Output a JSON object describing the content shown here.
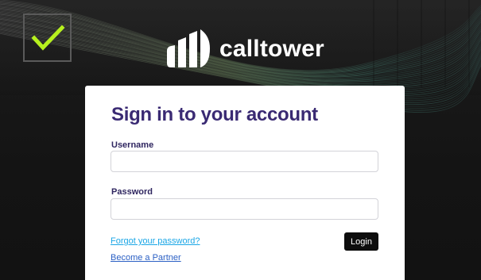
{
  "app": {
    "brand_name": "calltower"
  },
  "icons": {
    "status": "checkmark-icon",
    "logo": "calltower-logo-icon"
  },
  "colors": {
    "check_accent": "#b6f01e",
    "title": "#3a2a73",
    "link": "#1a9ee0",
    "button_bg": "#0d0d0d"
  },
  "login": {
    "title": "Sign in to your account",
    "username_label": "Username",
    "username_value": "",
    "password_label": "Password",
    "password_value": "",
    "forgot_link": "Forgot your password?",
    "partner_link": "Become a Partner",
    "login_button": "Login"
  }
}
